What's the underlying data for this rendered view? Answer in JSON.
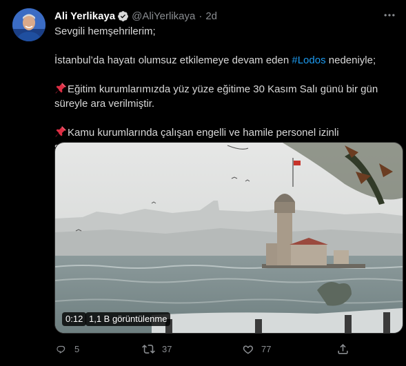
{
  "user": {
    "display_name": "Ali Yerlikaya",
    "handle": "@AliYerlikaya",
    "separator": "·",
    "timestamp": "2d"
  },
  "tweet": {
    "line1": "Sevgili hemşehrilerim;",
    "line2_pre": "İstanbul’da hayatı olumsuz etkilemeye devam eden ",
    "hashtag": "#Lodos",
    "line2_post": " nedeniyle;",
    "line3": "Eğitim kurumlarımızda yüz yüze eğitime 30 Kasım Salı günü bir gün süreyle ara verilmiştir.",
    "line4": "Kamu kurumlarında çalışan engelli ve hamile personel izinli sayılacaktır."
  },
  "media": {
    "duration": "0:12",
    "views": "1,1 B görüntülenme"
  },
  "actions": {
    "reply_count": "5",
    "retweet_count": "37",
    "like_count": "77"
  },
  "icons": [
    "verified-badge-icon",
    "more-icon",
    "pushpin-icon",
    "reply-icon",
    "retweet-icon",
    "like-icon",
    "share-icon"
  ],
  "colors": {
    "accent": "#1d9bf0",
    "background": "#000000",
    "secondary_text": "#8a8d91"
  }
}
